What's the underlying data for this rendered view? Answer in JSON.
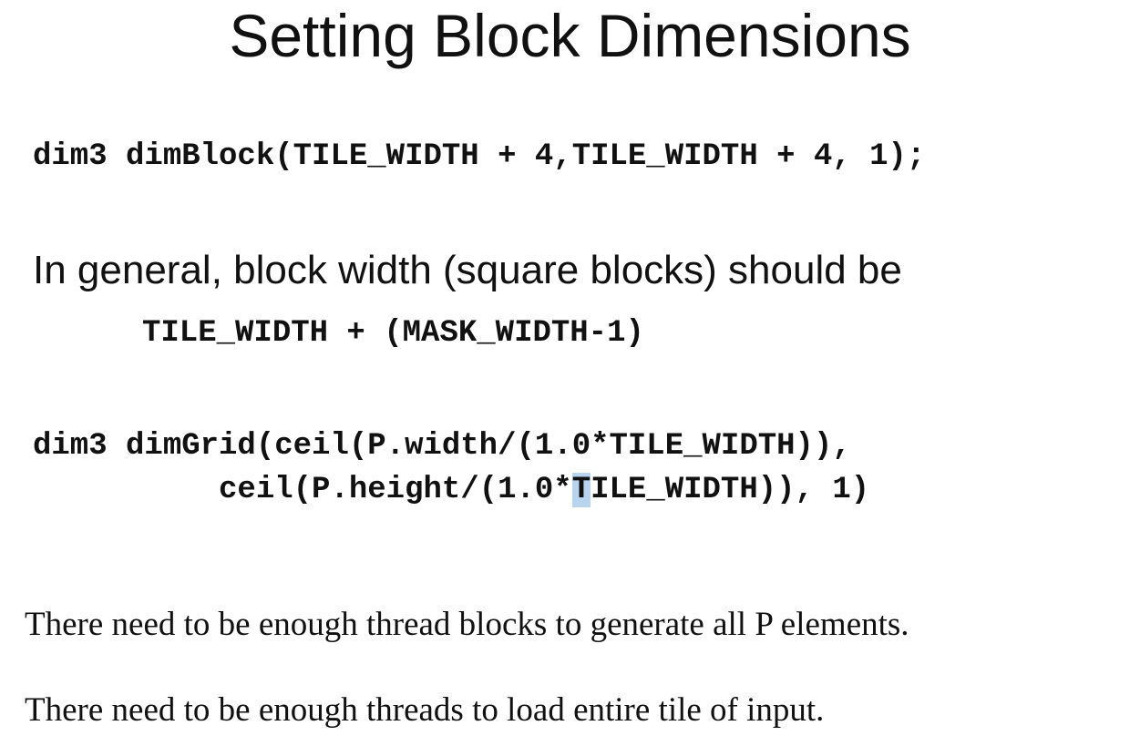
{
  "slide": {
    "title": "Setting Block Dimensions",
    "code_block_dim": "dim3 dimBlock(TILE_WIDTH + 4,TILE_WIDTH + 4, 1);",
    "general_statement": "In general, block width (square blocks) should be",
    "block_width_expr": "TILE_WIDTH + (MASK_WIDTH-1)",
    "code_grid_line1": "dim3 dimGrid(ceil(P.width/(1.0*TILE_WIDTH)),",
    "code_grid_line2_pre": "          ceil(P.height/(1.0*",
    "code_grid_line2_sel": "T",
    "code_grid_line2_post": "ILE_WIDTH)), 1)",
    "note_blocks": "There need to be enough thread blocks to generate all P elements.",
    "note_threads": "There need to be enough threads to load entire tile of input."
  },
  "colors": {
    "text": "#111111",
    "selection_highlight": "#b8d4ee",
    "background": "#ffffff"
  }
}
